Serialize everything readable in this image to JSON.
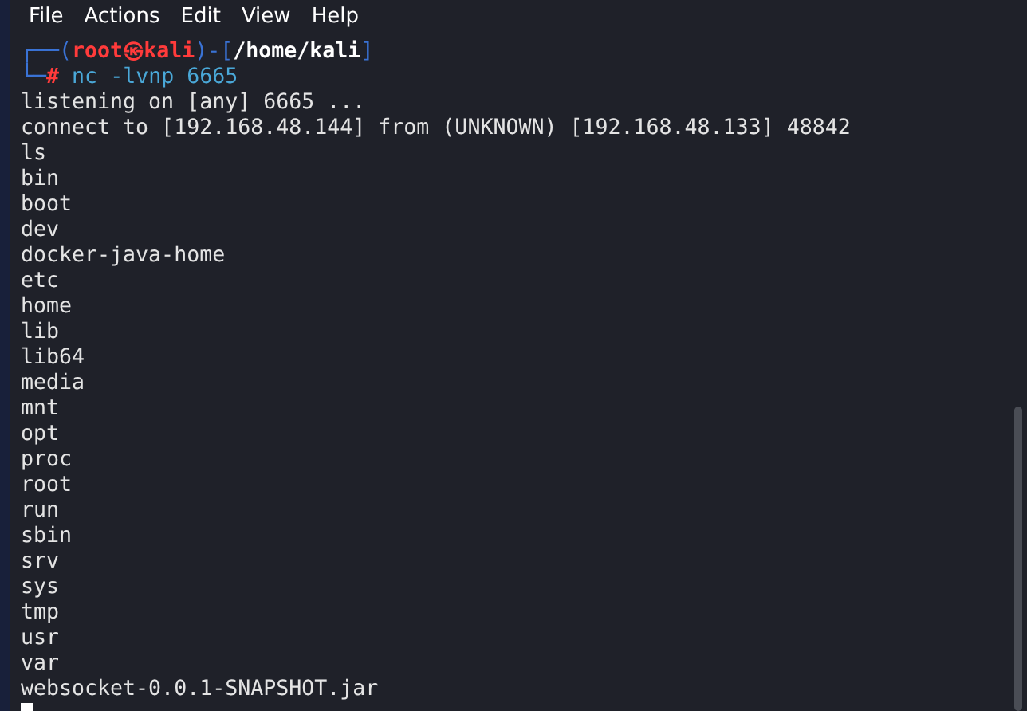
{
  "menu": [
    "File",
    "Actions",
    "Edit",
    "View",
    "Help"
  ],
  "terminal": {
    "prompt": {
      "top": "┌──(",
      "user": "root",
      "at": "㉿",
      "host": "kali",
      "mid": ")-[",
      "path": "/home/kali",
      "end": "]",
      "bottom": "└─",
      "symbol": "#",
      "command": "nc -lvnp 6665"
    },
    "lines": [
      "listening on [any] 6665 ...",
      "connect to [192.168.48.144] from (UNKNOWN) [192.168.48.133] 48842",
      "ls",
      "bin",
      "boot",
      "dev",
      "docker-java-home",
      "etc",
      "home",
      "lib",
      "lib64",
      "media",
      "mnt",
      "opt",
      "proc",
      "root",
      "run",
      "sbin",
      "srv",
      "sys",
      "tmp",
      "usr",
      "var",
      "websocket-0.0.1-SNAPSHOT.jar"
    ]
  }
}
